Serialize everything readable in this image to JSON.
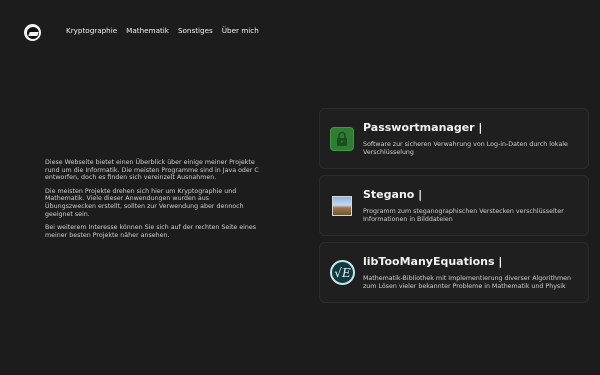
{
  "nav": {
    "items": [
      {
        "label": "Kryptographie"
      },
      {
        "label": "Mathematik"
      },
      {
        "label": "Sonstiges"
      },
      {
        "label": "Über mich"
      }
    ]
  },
  "intro": {
    "paragraphs": [
      "Diese Webseite bietet einen Überblick über einige meiner Projekte rund um die Informatik. Die meisten Programme sind in Java oder C entworfen, doch es finden sich vereinzelt Ausnahmen.",
      "Die meisten Projekte drehen sich hier um Kryptographie und Mathematik. Viele dieser Anwendungen wurden aus Übungszwecken erstellt, sollten zur Verwendung aber dennoch geeignet sein.",
      "Bei weiterem Interesse können Sie sich auf der rechten Seite eines meiner besten Projekte näher ansehen."
    ]
  },
  "projects": [
    {
      "title": "Passwortmanager |",
      "description": "Software zur sicheren Verwahrung von Log-in-Daten durch lokale Verschlüsselung",
      "icon": "lock-icon",
      "accent": "#2e7d32"
    },
    {
      "title": "Stegano |",
      "description": "Programm zum steganographischen Verstecken verschlüsselter Informationen in Bilddateien",
      "icon": "landscape-image-icon",
      "accent": "#8ab6e8"
    },
    {
      "title": "libTooManyEquations |",
      "description": "Mathematik-Bibliothek mit Implementierung diverser Algorithmen zum Lösen vieler bekannter Probleme in Mathematik und Physik",
      "icon": "math-logo-icon",
      "accent": "#0e3a40"
    }
  ],
  "lib_icon_glyph": "√E"
}
